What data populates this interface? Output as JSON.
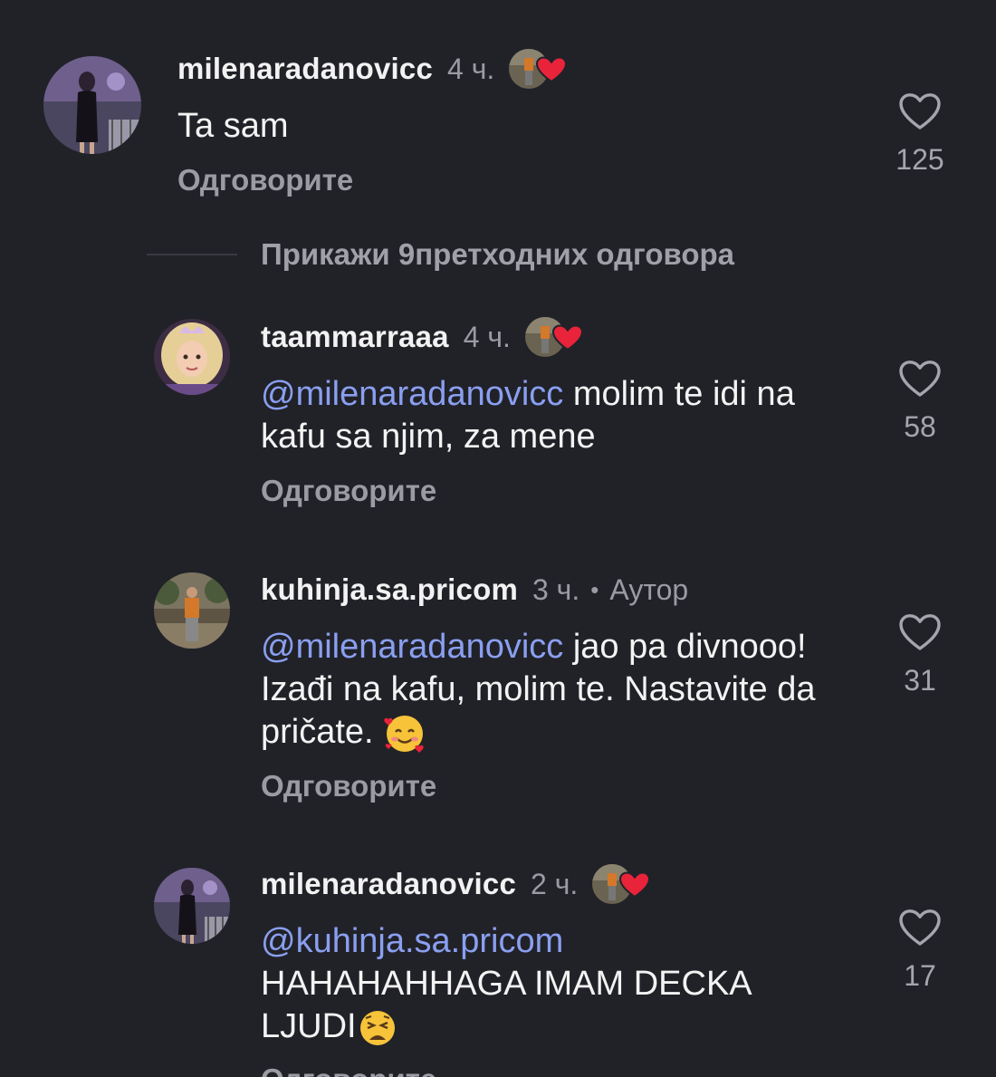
{
  "comments": [
    {
      "username": "milenaradanovicc",
      "time": "4 ч.",
      "mention": "",
      "text": "Ta sam",
      "reply_label": "Одговорите",
      "likes": "125",
      "liked_by_author": true,
      "is_author": false
    },
    {
      "username": "taammarraaa",
      "time": "4 ч.",
      "mention": "@milenaradanovicc",
      "text": "molim te idi na kafu sa njim, za mene",
      "reply_label": "Одговорите",
      "likes": "58",
      "liked_by_author": true,
      "is_author": false
    },
    {
      "username": "kuhinja.sa.pricom",
      "time": "3 ч.",
      "author_label": "Аутор",
      "mention": "@milenaradanovicc",
      "text": "jao pa divnooo! Izađi na kafu, molim te. Nastavite da pričate.",
      "reply_label": "Одговорите",
      "likes": "31",
      "liked_by_author": false,
      "is_author": true
    },
    {
      "username": "milenaradanovicc",
      "time": "2 ч.",
      "mention": "@kuhinja.sa.pricom",
      "text": "HAHAHAHHAGA IMAM DECKA LJUDI",
      "reply_label": "Одговорите",
      "likes": "17",
      "liked_by_author": true,
      "is_author": false
    }
  ],
  "view_previous_replies": "Прикажи 9претходних одговора",
  "icons": {
    "like": "heart-outline-icon",
    "liked_by_author": "red-heart-icon",
    "mention_symbol": "threads-at-icon",
    "emoji_3": "smiling-face-with-hearts-emoji",
    "emoji_4": "weary-face-emoji"
  },
  "colors": {
    "background": "#212228",
    "mention": "#8a9ff0",
    "secondary_text": "#9a9ba3",
    "heart_red": "#e8233a"
  }
}
